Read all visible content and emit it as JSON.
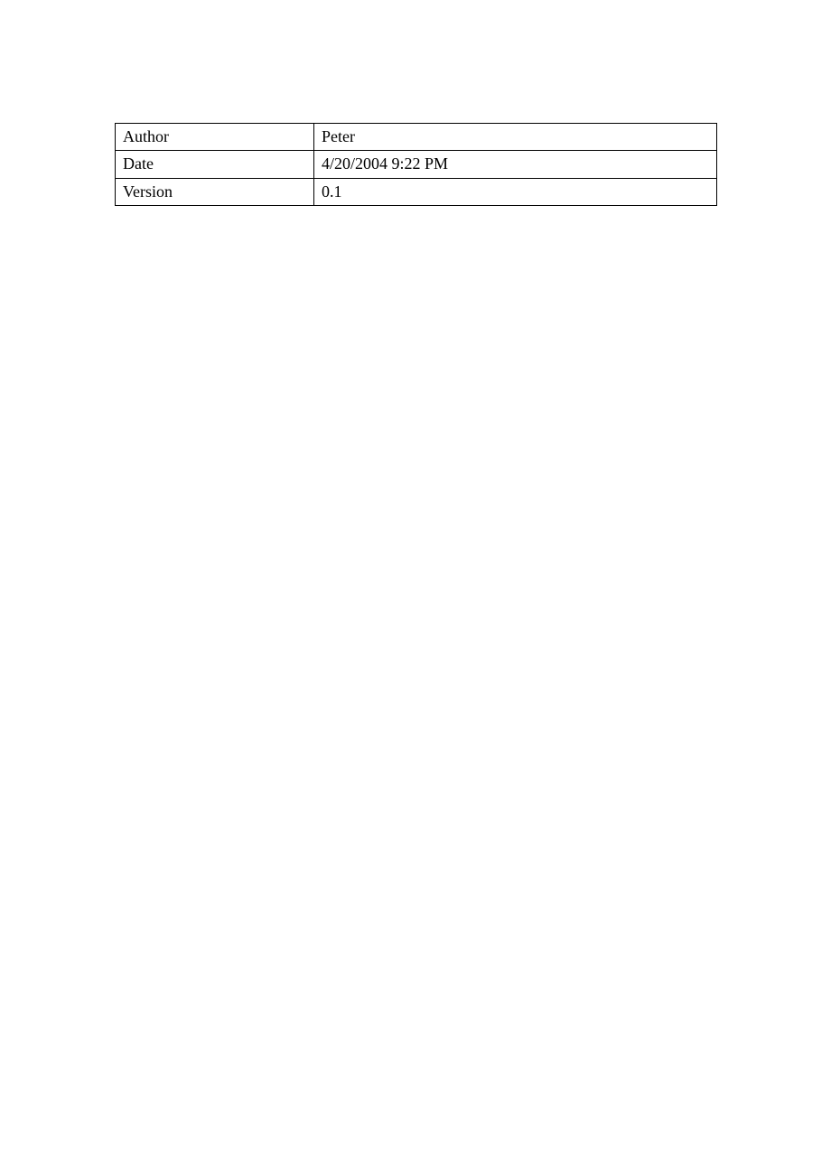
{
  "metadata": {
    "rows": [
      {
        "label": "Author",
        "value": "Peter"
      },
      {
        "label": "Date",
        "value": "4/20/2004 9:22 PM"
      },
      {
        "label": "Version",
        "value": "0.1"
      }
    ]
  }
}
